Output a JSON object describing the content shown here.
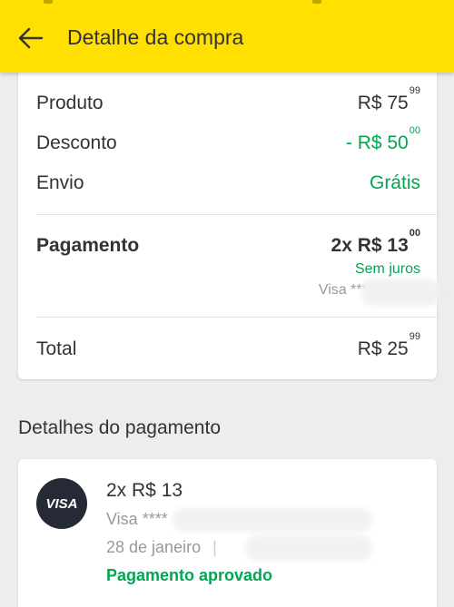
{
  "header": {
    "title": "Detalhe da compra"
  },
  "summary": {
    "product": {
      "label": "Produto",
      "value": "R$ 75",
      "cents": "99"
    },
    "discount": {
      "label": "Desconto",
      "value": "- R$ 50",
      "cents": "00"
    },
    "shipping": {
      "label": "Envio",
      "value": "Grátis"
    },
    "payment": {
      "label": "Pagamento",
      "value": "2x R$ 13",
      "cents": "00",
      "interest": "Sem juros",
      "card": "Visa ****"
    },
    "total": {
      "label": "Total",
      "value": "R$ 25",
      "cents": "99"
    }
  },
  "payment_details": {
    "section_title": "Detalhes do pagamento",
    "brand_badge": "VISA",
    "amount": "2x R$ 13",
    "card": "Visa ****",
    "date": "28 de janeiro",
    "separator": "|",
    "status": "Pagamento aprovado"
  },
  "colors": {
    "header_bg": "#ffe000",
    "accent_green": "#00a650",
    "visa_badge_bg": "#252a36"
  },
  "icons": {
    "back": "arrow-left-icon"
  }
}
